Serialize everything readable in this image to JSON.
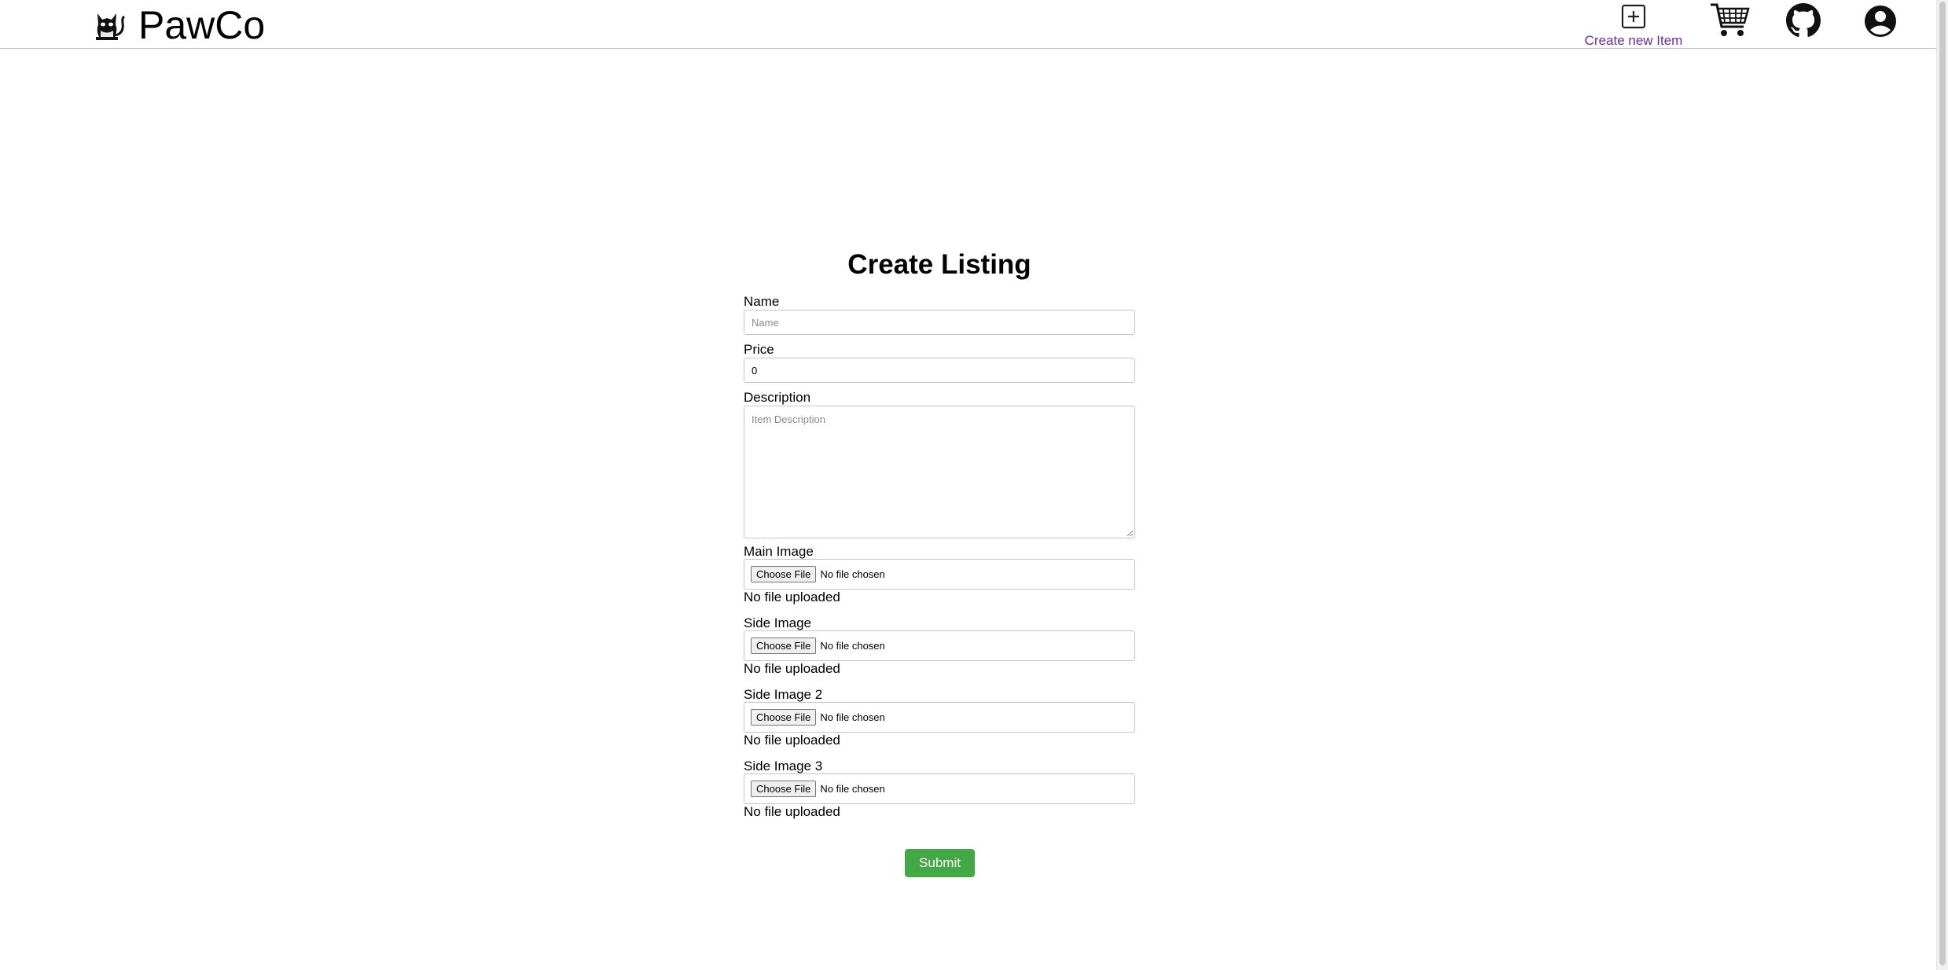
{
  "header": {
    "brand_name": "PawCo",
    "logo_icon": "cat-icon",
    "create_item_label": "Create new Item",
    "icons": [
      "plus-square-icon",
      "shopping-cart-icon",
      "github-icon",
      "account-circle-icon"
    ],
    "link_color": "#6a2aa0"
  },
  "form": {
    "title": "Create Listing",
    "name": {
      "label": "Name",
      "value": "",
      "placeholder": "Name"
    },
    "price": {
      "label": "Price",
      "value": "0"
    },
    "description": {
      "label": "Description",
      "value": "",
      "placeholder": "Item Description"
    },
    "files": [
      {
        "label": "Main Image",
        "button": "Choose File",
        "status": "No file chosen",
        "note": "No file uploaded"
      },
      {
        "label": "Side Image",
        "button": "Choose File",
        "status": "No file chosen",
        "note": "No file uploaded"
      },
      {
        "label": "Side Image 2",
        "button": "Choose File",
        "status": "No file chosen",
        "note": "No file uploaded"
      },
      {
        "label": "Side Image 3",
        "button": "Choose File",
        "status": "No file chosen",
        "note": "No file uploaded"
      }
    ],
    "submit_label": "Submit",
    "submit_color": "#45a846"
  }
}
